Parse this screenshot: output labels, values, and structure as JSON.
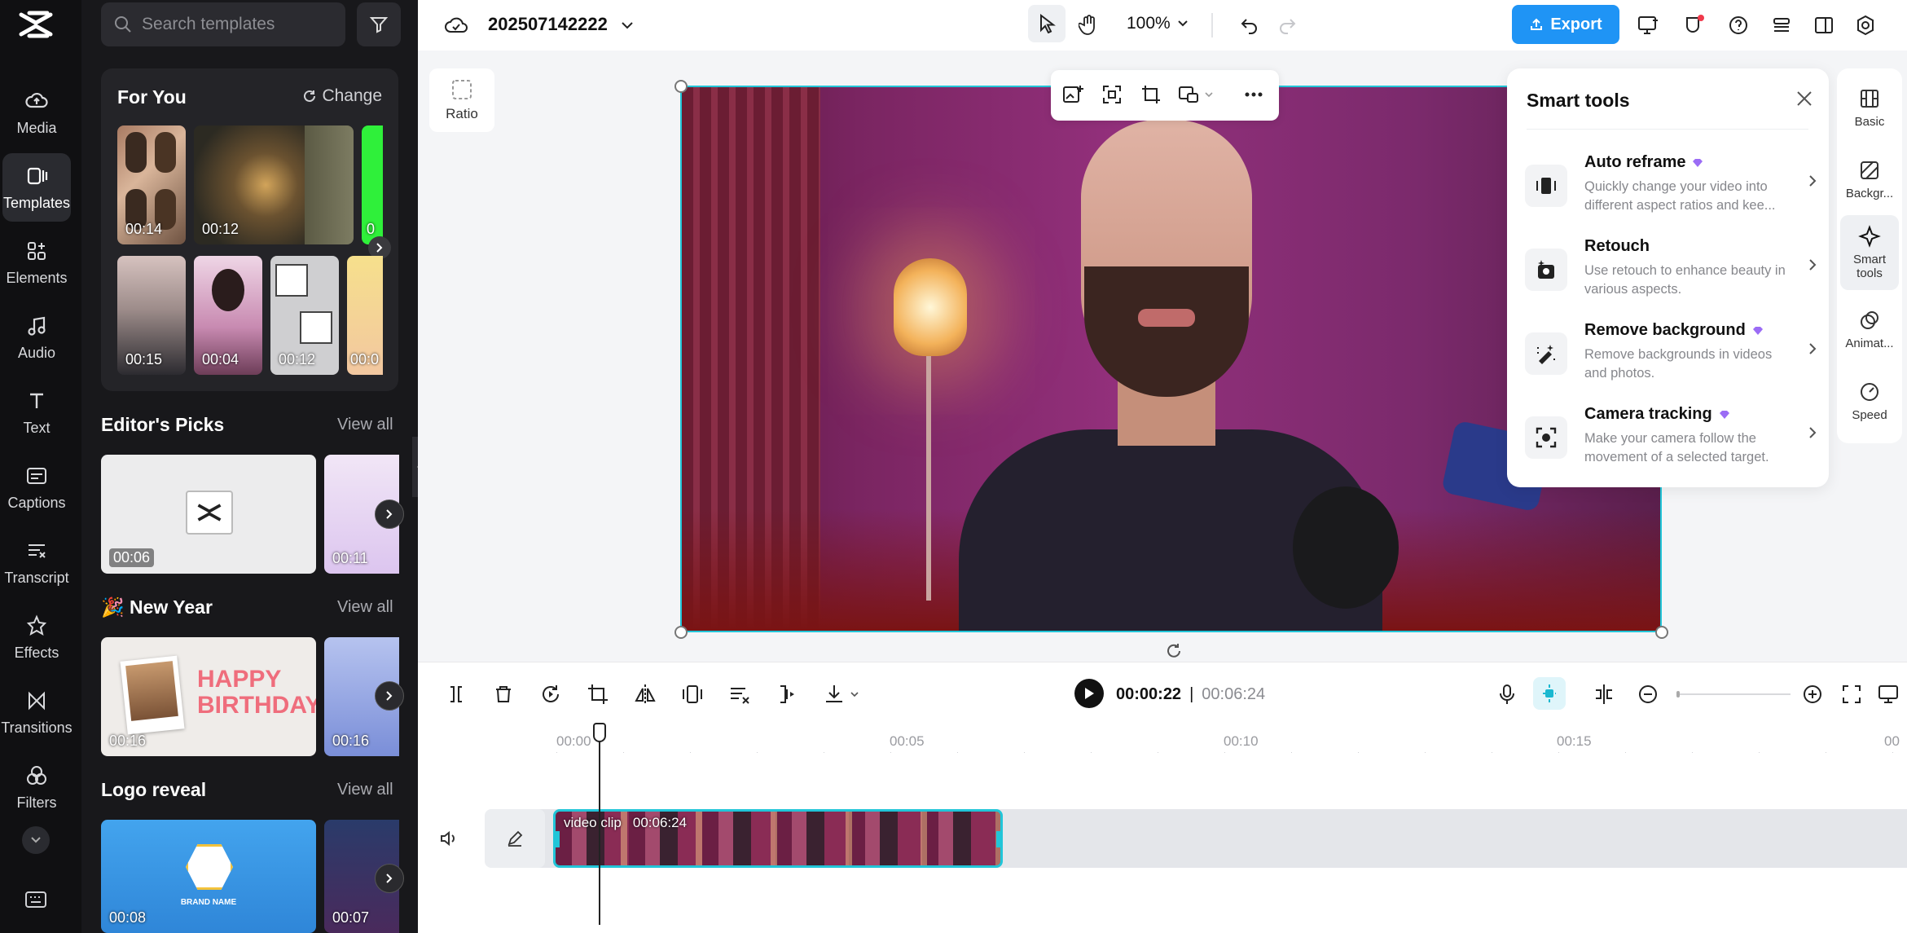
{
  "rail": {
    "items": [
      {
        "label": "Media",
        "icon": "cloud-upload-icon"
      },
      {
        "label": "Templates",
        "icon": "templates-icon"
      },
      {
        "label": "Elements",
        "icon": "elements-icon"
      },
      {
        "label": "Audio",
        "icon": "music-note-icon"
      },
      {
        "label": "Text",
        "icon": "text-icon"
      },
      {
        "label": "Captions",
        "icon": "captions-icon"
      },
      {
        "label": "Transcript",
        "icon": "transcript-icon"
      },
      {
        "label": "Effects",
        "icon": "effects-icon"
      },
      {
        "label": "Transitions",
        "icon": "transitions-icon"
      },
      {
        "label": "Filters",
        "icon": "filters-icon"
      }
    ],
    "active": "Templates"
  },
  "panel": {
    "search_placeholder": "Search templates",
    "for_you": {
      "title": "For You",
      "change": "Change",
      "durations": [
        "00:14",
        "00:12",
        "0",
        "00:15",
        "00:04",
        "00:12",
        "00:0"
      ]
    },
    "editors_picks": {
      "title": "Editor's Picks",
      "view_all": "View all",
      "durations": [
        "00:06",
        "00:11"
      ]
    },
    "new_year": {
      "title": "New Year",
      "emoji": "🎉",
      "view_all": "View all",
      "durations": [
        "00:16",
        "00:16"
      ],
      "thumb_text": [
        "HAPPY",
        "BIRTHDAY"
      ]
    },
    "logo_reveal": {
      "title": "Logo reveal",
      "view_all": "View all",
      "durations": [
        "00:08",
        "00:07"
      ],
      "thumb_text": "BRAND NAME"
    }
  },
  "topbar": {
    "project_name": "202507142222",
    "zoom": "100%",
    "export_label": "Export"
  },
  "canvas": {
    "ratio_label": "Ratio"
  },
  "smart_tools": {
    "title": "Smart tools",
    "items": [
      {
        "name": "Auto reframe",
        "desc": "Quickly change your video into different aspect ratios and kee...",
        "premium": true
      },
      {
        "name": "Retouch",
        "desc": "Use retouch to enhance beauty in various aspects.",
        "premium": false
      },
      {
        "name": "Remove background",
        "desc": "Remove backgrounds in videos and photos.",
        "premium": true
      },
      {
        "name": "Camera tracking",
        "desc": "Make your camera follow the movement of a selected target.",
        "premium": true
      }
    ]
  },
  "right_props": [
    {
      "label": "Basic"
    },
    {
      "label": "Backgr..."
    },
    {
      "label": "Smart tools"
    },
    {
      "label": "Animat..."
    },
    {
      "label": "Speed"
    }
  ],
  "player": {
    "current_time": "00:00:22",
    "separator": "|",
    "total_time": "00:06:24"
  },
  "timeline": {
    "ruler": [
      "00:00",
      "00:05",
      "00:10",
      "00:15",
      "00"
    ],
    "clip_name": "video clip",
    "clip_duration": "00:06:24"
  },
  "colors": {
    "accent": "#1f94f5",
    "selection": "#21c5d8",
    "premium": "#9b6cf5"
  }
}
